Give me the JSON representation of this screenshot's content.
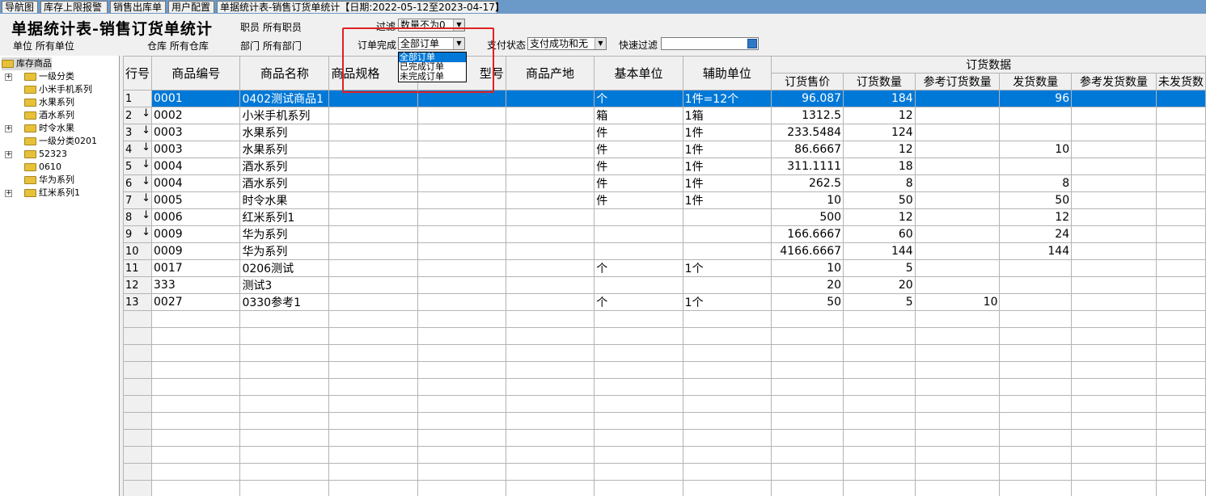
{
  "tabs": [
    {
      "label": "导航图"
    },
    {
      "label": "库存上限报警"
    },
    {
      "label": "销售出库单"
    },
    {
      "label": "用户配置"
    },
    {
      "label": "单据统计表-销售订货单统计【日期:2022-05-12至2023-04-17】"
    }
  ],
  "header": {
    "title": "单据统计表-销售订货单统计",
    "unit_label": "单位 所有单位",
    "warehouse_label": "仓库 所有仓库",
    "staff_label": "职员 所有职员",
    "dept_label": "部门 所有部门",
    "filter_label": "过滤",
    "filter_value": "数量不为0",
    "order_complete_label": "订单完成",
    "order_complete_value": "全部订单",
    "pay_status_label": "支付状态",
    "pay_status_value": "支付成功和无",
    "quick_filter_label": "快速过滤",
    "quick_filter_value": ""
  },
  "dropdown": {
    "options": [
      "全部订单",
      "已完成订单",
      "未完成订单"
    ],
    "selected": "全部订单"
  },
  "tree": {
    "root": "库存商品",
    "items": [
      {
        "label": "一级分类",
        "expandable": true
      },
      {
        "label": "小米手机系列",
        "expandable": false
      },
      {
        "label": "水果系列",
        "expandable": false
      },
      {
        "label": "酒水系列",
        "expandable": false
      },
      {
        "label": "时令水果",
        "expandable": true
      },
      {
        "label": "一级分类0201",
        "expandable": false
      },
      {
        "label": "52323",
        "expandable": true
      },
      {
        "label": "0610",
        "expandable": false
      },
      {
        "label": "华为系列",
        "expandable": false
      },
      {
        "label": "红米系列1",
        "expandable": true
      }
    ]
  },
  "grid": {
    "group_header": "订货数据",
    "columns": [
      "行号",
      "商品编号",
      "商品名称",
      "商品规格",
      "型号",
      "商品产地",
      "基本单位",
      "辅助单位",
      "订货售价",
      "订货数量",
      "参考订货数量",
      "发货数量",
      "参考发货数量",
      "未发货数"
    ],
    "rows": [
      {
        "no": "1",
        "code": "0001",
        "name": "0402测试商品1",
        "unit": "个",
        "aux": "1件=12个",
        "price": "96.087",
        "qty": "184",
        "ref_qty": "",
        "ship": "96",
        "arrow": false
      },
      {
        "no": "2",
        "code": "0002",
        "name": "小米手机系列",
        "unit": "箱",
        "aux": "1箱",
        "price": "1312.5",
        "qty": "12",
        "ref_qty": "",
        "ship": "",
        "arrow": true
      },
      {
        "no": "3",
        "code": "0003",
        "name": "水果系列",
        "unit": "件",
        "aux": "1件",
        "price": "233.5484",
        "qty": "124",
        "ref_qty": "",
        "ship": "",
        "arrow": true
      },
      {
        "no": "4",
        "code": "0003",
        "name": "水果系列",
        "unit": "件",
        "aux": "1件",
        "price": "86.6667",
        "qty": "12",
        "ref_qty": "",
        "ship": "10",
        "arrow": true
      },
      {
        "no": "5",
        "code": "0004",
        "name": "酒水系列",
        "unit": "件",
        "aux": "1件",
        "price": "311.1111",
        "qty": "18",
        "ref_qty": "",
        "ship": "",
        "arrow": true
      },
      {
        "no": "6",
        "code": "0004",
        "name": "酒水系列",
        "unit": "件",
        "aux": "1件",
        "price": "262.5",
        "qty": "8",
        "ref_qty": "",
        "ship": "8",
        "arrow": true
      },
      {
        "no": "7",
        "code": "0005",
        "name": "时令水果",
        "unit": "件",
        "aux": "1件",
        "price": "10",
        "qty": "50",
        "ref_qty": "",
        "ship": "50",
        "arrow": true
      },
      {
        "no": "8",
        "code": "0006",
        "name": "红米系列1",
        "unit": "",
        "aux": "",
        "price": "500",
        "qty": "12",
        "ref_qty": "",
        "ship": "12",
        "arrow": true
      },
      {
        "no": "9",
        "code": "0009",
        "name": "华为系列",
        "unit": "",
        "aux": "",
        "price": "166.6667",
        "qty": "60",
        "ref_qty": "",
        "ship": "24",
        "arrow": true
      },
      {
        "no": "10",
        "code": "0009",
        "name": "华为系列",
        "unit": "",
        "aux": "",
        "price": "4166.6667",
        "qty": "144",
        "ref_qty": "",
        "ship": "144",
        "arrow": false
      },
      {
        "no": "11",
        "code": "0017",
        "name": "0206测试",
        "unit": "个",
        "aux": "1个",
        "price": "10",
        "qty": "5",
        "ref_qty": "",
        "ship": "",
        "arrow": false
      },
      {
        "no": "12",
        "code": "333",
        "name": "测试3",
        "unit": "",
        "aux": "",
        "price": "20",
        "qty": "20",
        "ref_qty": "",
        "ship": "",
        "arrow": false
      },
      {
        "no": "13",
        "code": "0027",
        "name": "0330参考1",
        "unit": "个",
        "aux": "1个",
        "price": "50",
        "qty": "5",
        "ref_qty": "10",
        "ship": "",
        "arrow": false
      }
    ]
  }
}
